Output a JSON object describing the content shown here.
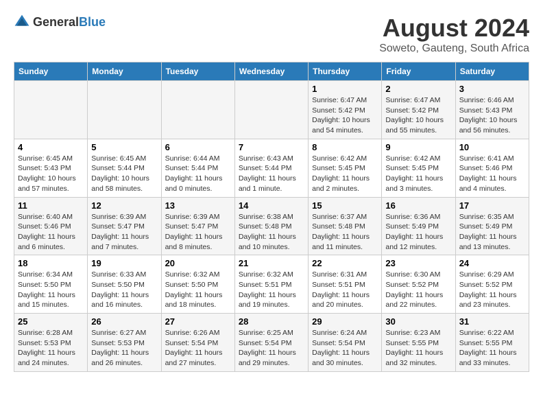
{
  "logo": {
    "text_general": "General",
    "text_blue": "Blue"
  },
  "title": "August 2024",
  "subtitle": "Soweto, Gauteng, South Africa",
  "days_of_week": [
    "Sunday",
    "Monday",
    "Tuesday",
    "Wednesday",
    "Thursday",
    "Friday",
    "Saturday"
  ],
  "weeks": [
    [
      {
        "day": "",
        "info": ""
      },
      {
        "day": "",
        "info": ""
      },
      {
        "day": "",
        "info": ""
      },
      {
        "day": "",
        "info": ""
      },
      {
        "day": "1",
        "info": "Sunrise: 6:47 AM\nSunset: 5:42 PM\nDaylight: 10 hours\nand 54 minutes."
      },
      {
        "day": "2",
        "info": "Sunrise: 6:47 AM\nSunset: 5:42 PM\nDaylight: 10 hours\nand 55 minutes."
      },
      {
        "day": "3",
        "info": "Sunrise: 6:46 AM\nSunset: 5:43 PM\nDaylight: 10 hours\nand 56 minutes."
      }
    ],
    [
      {
        "day": "4",
        "info": "Sunrise: 6:45 AM\nSunset: 5:43 PM\nDaylight: 10 hours\nand 57 minutes."
      },
      {
        "day": "5",
        "info": "Sunrise: 6:45 AM\nSunset: 5:44 PM\nDaylight: 10 hours\nand 58 minutes."
      },
      {
        "day": "6",
        "info": "Sunrise: 6:44 AM\nSunset: 5:44 PM\nDaylight: 11 hours\nand 0 minutes."
      },
      {
        "day": "7",
        "info": "Sunrise: 6:43 AM\nSunset: 5:44 PM\nDaylight: 11 hours\nand 1 minute."
      },
      {
        "day": "8",
        "info": "Sunrise: 6:42 AM\nSunset: 5:45 PM\nDaylight: 11 hours\nand 2 minutes."
      },
      {
        "day": "9",
        "info": "Sunrise: 6:42 AM\nSunset: 5:45 PM\nDaylight: 11 hours\nand 3 minutes."
      },
      {
        "day": "10",
        "info": "Sunrise: 6:41 AM\nSunset: 5:46 PM\nDaylight: 11 hours\nand 4 minutes."
      }
    ],
    [
      {
        "day": "11",
        "info": "Sunrise: 6:40 AM\nSunset: 5:46 PM\nDaylight: 11 hours\nand 6 minutes."
      },
      {
        "day": "12",
        "info": "Sunrise: 6:39 AM\nSunset: 5:47 PM\nDaylight: 11 hours\nand 7 minutes."
      },
      {
        "day": "13",
        "info": "Sunrise: 6:39 AM\nSunset: 5:47 PM\nDaylight: 11 hours\nand 8 minutes."
      },
      {
        "day": "14",
        "info": "Sunrise: 6:38 AM\nSunset: 5:48 PM\nDaylight: 11 hours\nand 10 minutes."
      },
      {
        "day": "15",
        "info": "Sunrise: 6:37 AM\nSunset: 5:48 PM\nDaylight: 11 hours\nand 11 minutes."
      },
      {
        "day": "16",
        "info": "Sunrise: 6:36 AM\nSunset: 5:49 PM\nDaylight: 11 hours\nand 12 minutes."
      },
      {
        "day": "17",
        "info": "Sunrise: 6:35 AM\nSunset: 5:49 PM\nDaylight: 11 hours\nand 13 minutes."
      }
    ],
    [
      {
        "day": "18",
        "info": "Sunrise: 6:34 AM\nSunset: 5:50 PM\nDaylight: 11 hours\nand 15 minutes."
      },
      {
        "day": "19",
        "info": "Sunrise: 6:33 AM\nSunset: 5:50 PM\nDaylight: 11 hours\nand 16 minutes."
      },
      {
        "day": "20",
        "info": "Sunrise: 6:32 AM\nSunset: 5:50 PM\nDaylight: 11 hours\nand 18 minutes."
      },
      {
        "day": "21",
        "info": "Sunrise: 6:32 AM\nSunset: 5:51 PM\nDaylight: 11 hours\nand 19 minutes."
      },
      {
        "day": "22",
        "info": "Sunrise: 6:31 AM\nSunset: 5:51 PM\nDaylight: 11 hours\nand 20 minutes."
      },
      {
        "day": "23",
        "info": "Sunrise: 6:30 AM\nSunset: 5:52 PM\nDaylight: 11 hours\nand 22 minutes."
      },
      {
        "day": "24",
        "info": "Sunrise: 6:29 AM\nSunset: 5:52 PM\nDaylight: 11 hours\nand 23 minutes."
      }
    ],
    [
      {
        "day": "25",
        "info": "Sunrise: 6:28 AM\nSunset: 5:53 PM\nDaylight: 11 hours\nand 24 minutes."
      },
      {
        "day": "26",
        "info": "Sunrise: 6:27 AM\nSunset: 5:53 PM\nDaylight: 11 hours\nand 26 minutes."
      },
      {
        "day": "27",
        "info": "Sunrise: 6:26 AM\nSunset: 5:54 PM\nDaylight: 11 hours\nand 27 minutes."
      },
      {
        "day": "28",
        "info": "Sunrise: 6:25 AM\nSunset: 5:54 PM\nDaylight: 11 hours\nand 29 minutes."
      },
      {
        "day": "29",
        "info": "Sunrise: 6:24 AM\nSunset: 5:54 PM\nDaylight: 11 hours\nand 30 minutes."
      },
      {
        "day": "30",
        "info": "Sunrise: 6:23 AM\nSunset: 5:55 PM\nDaylight: 11 hours\nand 32 minutes."
      },
      {
        "day": "31",
        "info": "Sunrise: 6:22 AM\nSunset: 5:55 PM\nDaylight: 11 hours\nand 33 minutes."
      }
    ]
  ]
}
